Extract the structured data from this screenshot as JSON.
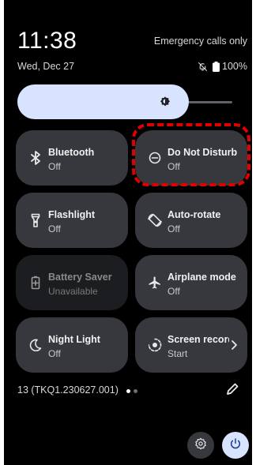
{
  "status": {
    "time": "11:38",
    "emergency": "Emergency calls only",
    "date": "Wed, Dec 27",
    "battery": "100%"
  },
  "brightness": {
    "level": 0.76
  },
  "tiles": [
    {
      "label": "Bluetooth",
      "state": "Off",
      "icon": "bluetooth-icon"
    },
    {
      "label": "Do Not Disturb",
      "state": "Off",
      "icon": "do-not-disturb-icon"
    },
    {
      "label": "Flashlight",
      "state": "Off",
      "icon": "flashlight-icon"
    },
    {
      "label": "Auto-rotate",
      "state": "Off",
      "icon": "auto-rotate-icon"
    },
    {
      "label": "Battery Saver",
      "state": "Unavailable",
      "icon": "battery-saver-icon"
    },
    {
      "label": "Airplane mode",
      "state": "Off",
      "icon": "airplane-icon"
    },
    {
      "label": "Night Light",
      "state": "Off",
      "icon": "night-light-icon"
    },
    {
      "label": "Screen record",
      "state": "Start",
      "icon": "screen-record-icon"
    }
  ],
  "footer": {
    "build": "13 (TKQ1.230627.001)",
    "page_count": 2,
    "active_page": 1
  },
  "colors": {
    "accent": "#d7e3ff",
    "tile": "#36383d",
    "tile_disabled": "#1c1d20",
    "highlight": "#e00000"
  }
}
